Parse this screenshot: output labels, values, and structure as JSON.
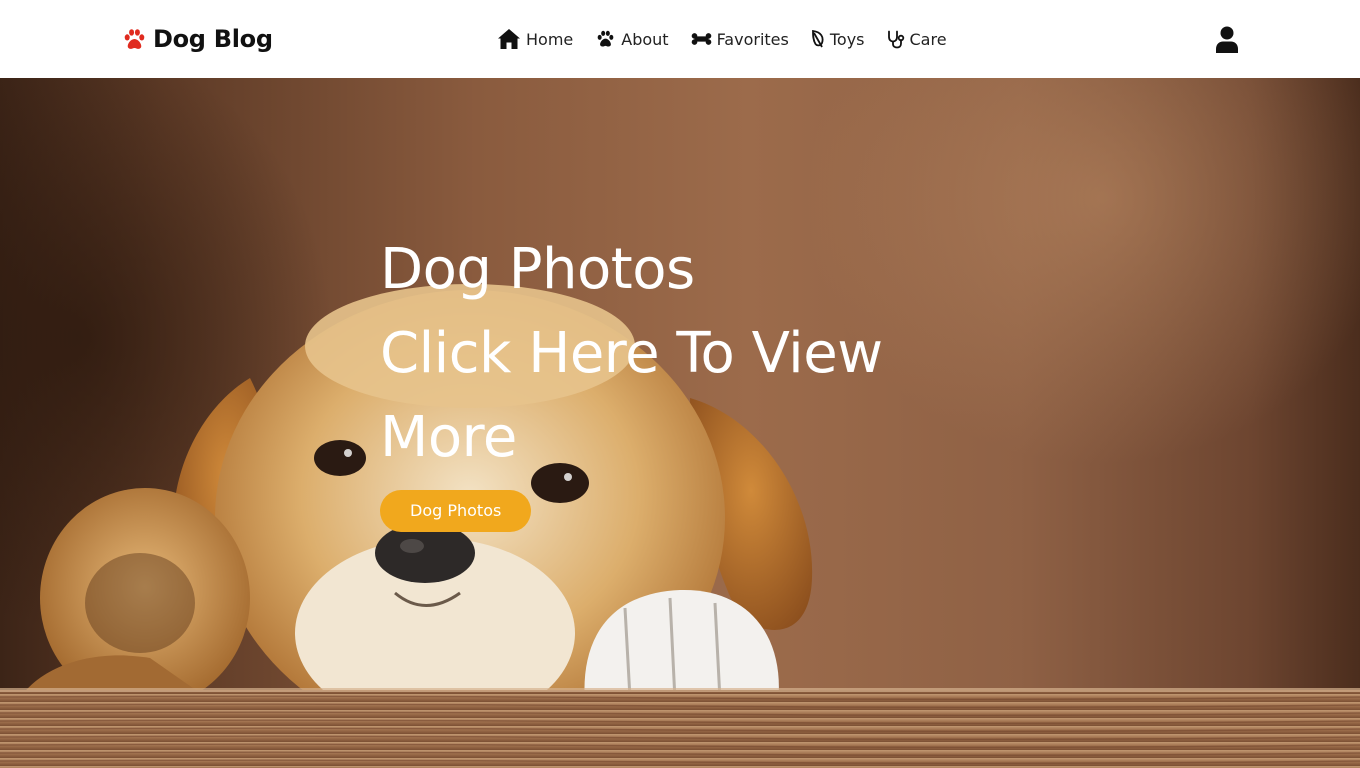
{
  "brand": {
    "name": "Dog Blog",
    "icon": "paw-icon",
    "icon_color": "#e02b1f"
  },
  "nav": {
    "items": [
      {
        "label": "Home",
        "icon": "home-icon"
      },
      {
        "label": "About",
        "icon": "paw-icon"
      },
      {
        "label": "Favorites",
        "icon": "bone-icon"
      },
      {
        "label": "Toys",
        "icon": "leaf-icon"
      },
      {
        "label": "Care",
        "icon": "stethoscope-icon"
      }
    ],
    "user_icon": "user-icon"
  },
  "hero": {
    "title_line1": "Dog Photos",
    "title_line2": "Click Here To View",
    "title_line3": "More",
    "button_label": "Dog Photos",
    "button_color": "#f1a81d"
  }
}
